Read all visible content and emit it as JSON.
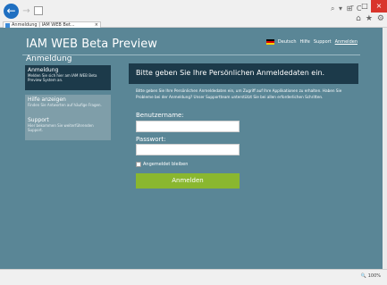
{
  "browser": {
    "tab_title": "Anmeldung | IAM WEB Bet...",
    "tab_close": "×",
    "nav_back": "←",
    "nav_forward": "→",
    "address_tools": "⌕ ▾ ⊞ C",
    "window_buttons": {
      "minimize": "–",
      "maximize": "□",
      "close": "×"
    },
    "toolbar_icons": {
      "home": "⌂",
      "favorites": "★",
      "settings": "⚙"
    },
    "zoom": "🔍 100%",
    "accent": "#1f6fc1"
  },
  "header": {
    "title": "IAM WEB Beta Preview",
    "links": {
      "language": "Deutsch",
      "help": "Hilfe",
      "support": "Support",
      "login": "Anmelden"
    }
  },
  "sidebar": {
    "section_title": "Anmeldung",
    "items": [
      {
        "title": "Anmeldung",
        "subtitle": "Melden Sie sich hier am IAM WEB Beta Preview System an."
      },
      {
        "title": "Hilfe anzeigen",
        "subtitle": "Finden Sie Antworten auf häufige Fragen."
      },
      {
        "title": "Support",
        "subtitle": "Hier bekommen Sie weiterführenden Support."
      }
    ]
  },
  "main": {
    "panel_title": "Bitte geben Sie Ihre Persönlichen Anmeldedaten ein.",
    "intro": "Bitte geben Sie Ihre Persönlichen Anmeldedaten ein, um Zugriff auf Ihre Applikationen zu erhalten. Haben Sie Probleme bei der Anmeldung? Unser Supportteam unterstützt Sie bei allen erforderlichen Schritten.",
    "username_label": "Benutzername:",
    "username_value": "",
    "password_label": "Passwort:",
    "password_value": "",
    "remember_label": "Angemeldet bleiben",
    "submit_label": "Anmelden"
  },
  "colors": {
    "background": "#5a8696",
    "panel": "#1c3a4a",
    "sidebar_inactive": "#7f9ea9",
    "button": "#8ab72f"
  }
}
